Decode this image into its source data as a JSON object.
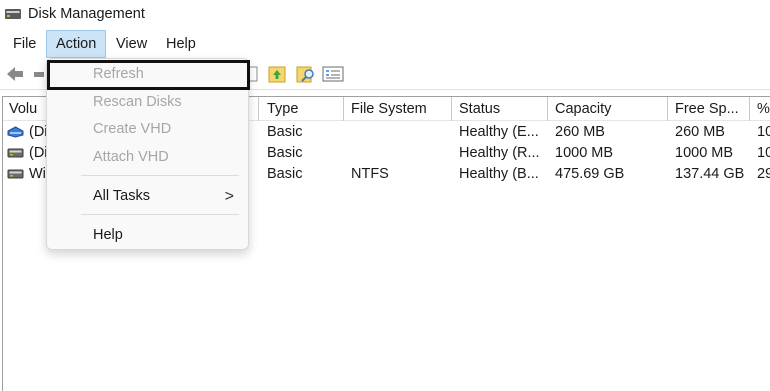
{
  "window": {
    "title": "Disk Management",
    "app_icon": "disk-management-icon"
  },
  "menubar": {
    "items": [
      {
        "label": "File"
      },
      {
        "label": "Action"
      },
      {
        "label": "View"
      },
      {
        "label": "Help"
      }
    ],
    "active": "Action"
  },
  "toolbar": {
    "buttons": [
      "back-arrow-icon",
      "forward-arrow-icon",
      "properties-icon",
      "folder-up-icon",
      "folder-search-icon",
      "checklist-icon"
    ]
  },
  "table": {
    "columns": [
      {
        "label": "Volu"
      },
      {
        "label": "Type"
      },
      {
        "label": "File System"
      },
      {
        "label": "Status"
      },
      {
        "label": "Capacity"
      },
      {
        "label": "Free Sp..."
      },
      {
        "label": "%"
      }
    ],
    "rows": [
      {
        "volume": "(Di",
        "type": "Basic",
        "fs": "",
        "status": "Healthy (E...",
        "capacity": "260 MB",
        "free": "260 MB",
        "pct": "10",
        "icon": "system-disk-icon"
      },
      {
        "volume": "(Di",
        "type": "Basic",
        "fs": "",
        "status": "Healthy (R...",
        "capacity": "1000 MB",
        "free": "1000 MB",
        "pct": "10",
        "icon": "drive-icon"
      },
      {
        "volume": "Wi",
        "type": "Basic",
        "fs": "NTFS",
        "status": "Healthy (B...",
        "capacity": "475.69 GB",
        "free": "137.44 GB",
        "pct": "29",
        "icon": "drive-icon"
      }
    ]
  },
  "action_menu": {
    "items": [
      {
        "label": "Refresh",
        "disabled": true
      },
      {
        "label": "Rescan Disks",
        "disabled": true
      },
      {
        "label": "Create VHD",
        "disabled": true
      },
      {
        "label": "Attach VHD",
        "disabled": true
      },
      {
        "label": "All Tasks",
        "disabled": false,
        "submenu_arrow": ">"
      },
      {
        "label": "Help",
        "disabled": false
      }
    ]
  },
  "colors": {
    "menu_active_bg": "#cce4f7",
    "disabled_text": "#a6a6a6",
    "highlight_border": "#111111"
  }
}
